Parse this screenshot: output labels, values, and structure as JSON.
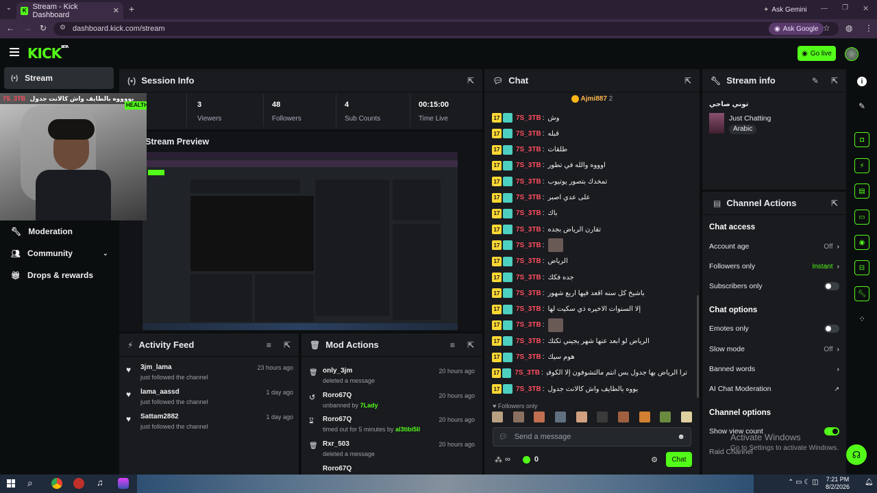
{
  "browser": {
    "tab_title": "Stream - Kick Dashboard",
    "url": "dashboard.kick.com/stream",
    "ask_gemini": "Ask Gemini",
    "ask_google": "Ask Google"
  },
  "header": {
    "logo": "KICK",
    "logo_badge": "BETA",
    "go_live": "Go live"
  },
  "sidebar": {
    "items": [
      {
        "label": "Stream",
        "icon": "broadcast-icon"
      },
      {
        "label": "Moderation",
        "icon": "wrench-icon"
      },
      {
        "label": "Community",
        "icon": "people-icon"
      },
      {
        "label": "Drops & rewards",
        "icon": "gift-icon"
      }
    ]
  },
  "session_info": {
    "title": "Session Info",
    "healthy": "HEALTHY",
    "stats": [
      {
        "value": "3",
        "label": "Viewers"
      },
      {
        "value": "48",
        "label": "Followers"
      },
      {
        "value": "4",
        "label": "Sub Counts"
      },
      {
        "value": "00:15:00",
        "label": "Time Live"
      }
    ]
  },
  "stream_preview": {
    "title": "Stream Preview",
    "overlay_name": "7S_3TB",
    "overlay_text": "يووووه بالطايف واش كالانت جدول"
  },
  "chat": {
    "title": "Chat",
    "top_user": "Ajmi887",
    "top_count": "2",
    "messages": [
      {
        "badge": "17",
        "user": "7S_3TB",
        "text": "وش"
      },
      {
        "badge": "17",
        "user": "7S_3TB",
        "text": "قبله"
      },
      {
        "badge": "17",
        "user": "7S_3TB",
        "text": "طلقات"
      },
      {
        "badge": "17",
        "user": "7S_3TB",
        "text": "اوووه والله في تطور"
      },
      {
        "badge": "17",
        "user": "7S_3TB",
        "text": "تمخدك بتصور يوتيوب"
      },
      {
        "badge": "17",
        "user": "7S_3TB",
        "text": "على عدي اصبر"
      },
      {
        "badge": "17",
        "user": "7S_3TB",
        "text": "باك"
      },
      {
        "badge": "17",
        "user": "7S_3TB",
        "text": "تقارن الرياض بجده"
      },
      {
        "badge": "17",
        "user": "7S_3TB",
        "text": ""
      },
      {
        "badge": "17",
        "user": "7S_3TB",
        "text": "الرياض"
      },
      {
        "badge": "17",
        "user": "7S_3TB",
        "text": "جده فكك"
      },
      {
        "badge": "17",
        "user": "7S_3TB",
        "text": "باشيخ كل سنه اقعد فيها اربع شهور"
      },
      {
        "badge": "17",
        "user": "7S_3TB",
        "text": "إلا السنوات الاخيره ذي سكيت لها"
      },
      {
        "badge": "17",
        "user": "7S_3TB",
        "text": ""
      },
      {
        "badge": "17",
        "user": "7S_3TB",
        "text": "الرياض لو ابعد عنها شهر يجيني تكتك"
      },
      {
        "badge": "17",
        "user": "7S_3TB",
        "text": "هوم سيك"
      },
      {
        "badge": "17",
        "user": "7S_3TB",
        "text": "ترا الرياض بها جدول بس انتم مالتشوفون إلا الكوفيات"
      },
      {
        "badge": "17",
        "user": "7S_3TB",
        "text": "يووه بالطايف واش كالانت جدول"
      }
    ],
    "followers_only": "Followers only",
    "input_placeholder": "Send a message",
    "points": "0",
    "send": "Chat",
    "infinity": "∞"
  },
  "stream_info": {
    "title": "Stream info",
    "stream_title": "توني صاحي",
    "category": "Just Chatting",
    "language": "Arabic"
  },
  "channel_actions": {
    "title": "Channel Actions",
    "chat_access": "Chat access",
    "account_age": "Account age",
    "account_age_val": "Off",
    "followers_only": "Followers only",
    "followers_only_val": "Instant",
    "subscribers_only": "Subscribers only",
    "chat_options": "Chat options",
    "emotes_only": "Emotes only",
    "slow_mode": "Slow mode",
    "slow_mode_val": "Off",
    "banned_words": "Banned words",
    "ai_moderation": "AI Chat Moderation",
    "channel_options": "Channel options",
    "show_view_count": "Show view count",
    "raid_channel": "Raid Channel"
  },
  "activity_feed": {
    "title": "Activity Feed",
    "items": [
      {
        "name": "3jm_lama",
        "sub": "just followed the channel",
        "time": "23 hours ago"
      },
      {
        "name": "lama_aassd",
        "sub": "just followed the channel",
        "time": "1 day ago"
      },
      {
        "name": "Sattam2882",
        "sub": "just followed the channel",
        "time": "1 day ago"
      }
    ]
  },
  "mod_actions": {
    "title": "Mod Actions",
    "items": [
      {
        "name": "only_3jm",
        "sub": "deleted a message",
        "extra": "",
        "time": "20 hours ago",
        "icon": "trash-icon"
      },
      {
        "name": "Roro67Q",
        "sub": "unbanned by",
        "extra": "7Lady",
        "time": "20 hours ago",
        "icon": "undo-icon"
      },
      {
        "name": "Roro67Q",
        "sub": "timed out for 5 minutes by",
        "extra": "al3tibi5ll",
        "time": "20 hours ago",
        "icon": "hourglass-icon"
      },
      {
        "name": "Rxr_503",
        "sub": "deleted a message",
        "extra": "",
        "time": "20 hours ago",
        "icon": "trash-icon"
      },
      {
        "name": "Roro67Q",
        "sub": "",
        "extra": "",
        "time": "",
        "icon": "trash-icon"
      }
    ]
  },
  "watermark": {
    "line1": "Activate Windows",
    "line2": "Go to Settings to activate Windows."
  },
  "taskbar": {
    "time": "7:21 PM",
    "date": "8/2/2026"
  },
  "colors": {
    "accent": "#53fc18",
    "panel": "#191b1f",
    "bg": "#0b0e0f",
    "username": "#ff4d5e"
  }
}
